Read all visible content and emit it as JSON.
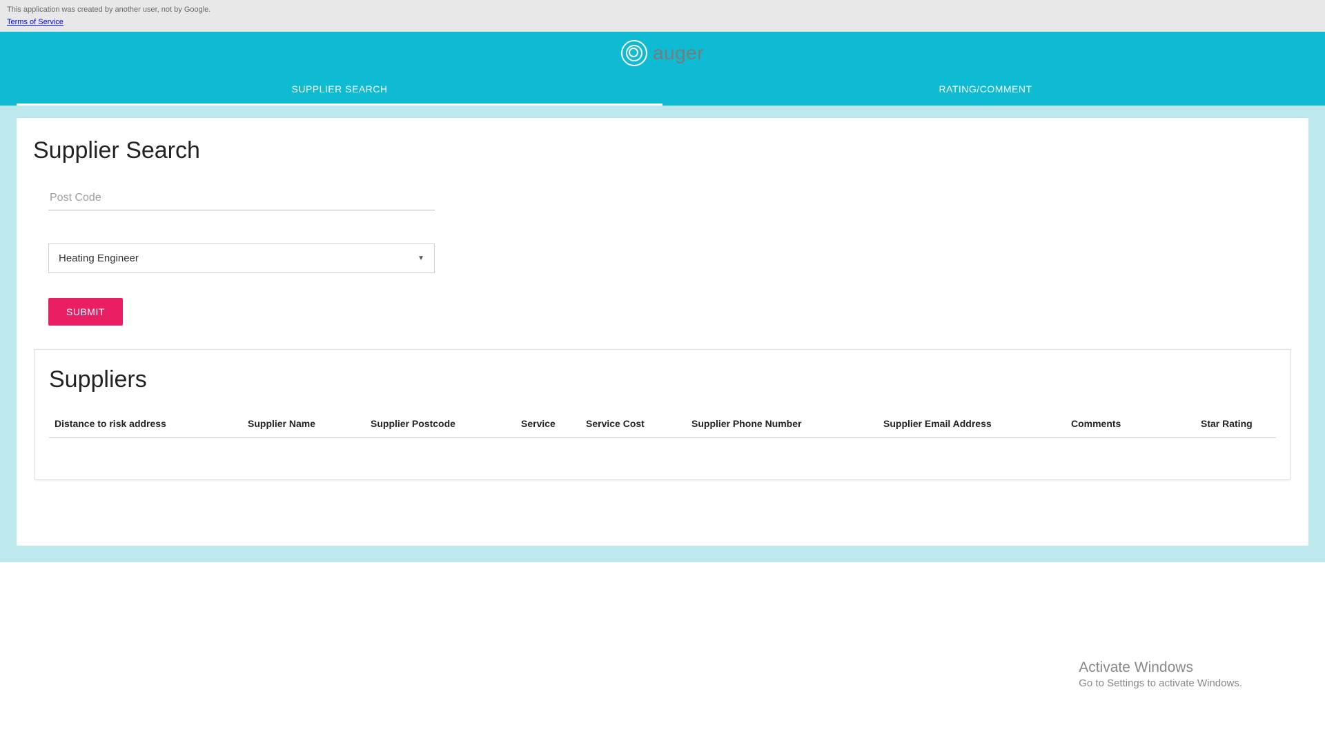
{
  "banner": {
    "disclaimer": "This application was created by another user, not by Google.",
    "tos_label": "Terms of Service"
  },
  "header": {
    "logo_text": "auger"
  },
  "nav": {
    "tabs": [
      {
        "label": "SUPPLIER SEARCH",
        "active": true
      },
      {
        "label": "RATING/COMMENT",
        "active": false
      }
    ]
  },
  "page": {
    "title": "Supplier Search"
  },
  "form": {
    "postcode_placeholder": "Post Code",
    "postcode_value": "",
    "service_selected": "Heating Engineer",
    "submit_label": "SUBMIT"
  },
  "suppliers": {
    "title": "Suppliers",
    "columns": {
      "distance": "Distance to risk address",
      "name": "Supplier Name",
      "postcode": "Supplier Postcode",
      "service": "Service",
      "cost": "Service Cost",
      "phone": "Supplier Phone Number",
      "email": "Supplier Email Address",
      "comments": "Comments",
      "rating": "Star Rating"
    },
    "rows": []
  },
  "watermark": {
    "line1": "Activate Windows",
    "line2": "Go to Settings to activate Windows."
  }
}
